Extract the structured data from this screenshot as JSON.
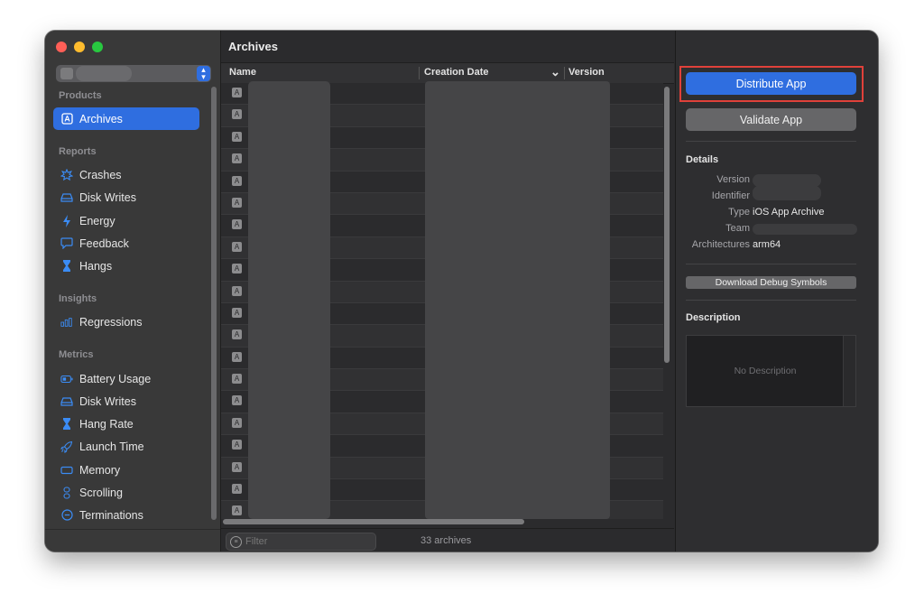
{
  "window": {
    "title": "Archives"
  },
  "sidebar": {
    "sections": [
      {
        "title": "Products",
        "items": [
          {
            "label": "Archives",
            "icon": "archive-icon",
            "selected": true
          }
        ]
      },
      {
        "title": "Reports",
        "items": [
          {
            "label": "Crashes",
            "icon": "crash-icon"
          },
          {
            "label": "Disk Writes",
            "icon": "disk-icon"
          },
          {
            "label": "Energy",
            "icon": "bolt-icon"
          },
          {
            "label": "Feedback",
            "icon": "speech-bubble-icon"
          },
          {
            "label": "Hangs",
            "icon": "hourglass-icon"
          }
        ]
      },
      {
        "title": "Insights",
        "items": [
          {
            "label": "Regressions",
            "icon": "bar-chart-icon"
          }
        ]
      },
      {
        "title": "Metrics",
        "items": [
          {
            "label": "Battery Usage",
            "icon": "battery-icon"
          },
          {
            "label": "Disk Writes",
            "icon": "disk-icon"
          },
          {
            "label": "Hang Rate",
            "icon": "hourglass-icon"
          },
          {
            "label": "Launch Time",
            "icon": "rocket-icon"
          },
          {
            "label": "Memory",
            "icon": "memory-icon"
          },
          {
            "label": "Scrolling",
            "icon": "scroll-icon"
          },
          {
            "label": "Terminations",
            "icon": "minus-circle-icon"
          }
        ]
      }
    ]
  },
  "table": {
    "columns": [
      "Name",
      "Creation Date",
      "Version"
    ],
    "sort_indicator": "⌄",
    "row_count_visible": 21
  },
  "footer": {
    "filter_placeholder": "Filter",
    "count_text": "33 archives"
  },
  "inspector": {
    "distribute_label": "Distribute App",
    "validate_label": "Validate App",
    "details_heading": "Details",
    "details": [
      {
        "key": "Version",
        "value": ""
      },
      {
        "key": "Identifier",
        "value": ""
      },
      {
        "key": "Type",
        "value": "iOS App Archive"
      },
      {
        "key": "Team",
        "value": ""
      },
      {
        "key": "Architectures",
        "value": "arm64"
      }
    ],
    "download_symbols_label": "Download Debug Symbols",
    "description_heading": "Description",
    "description_placeholder": "No Description"
  },
  "colors": {
    "accent": "#2f6ee0",
    "highlight": "#e0413a"
  }
}
